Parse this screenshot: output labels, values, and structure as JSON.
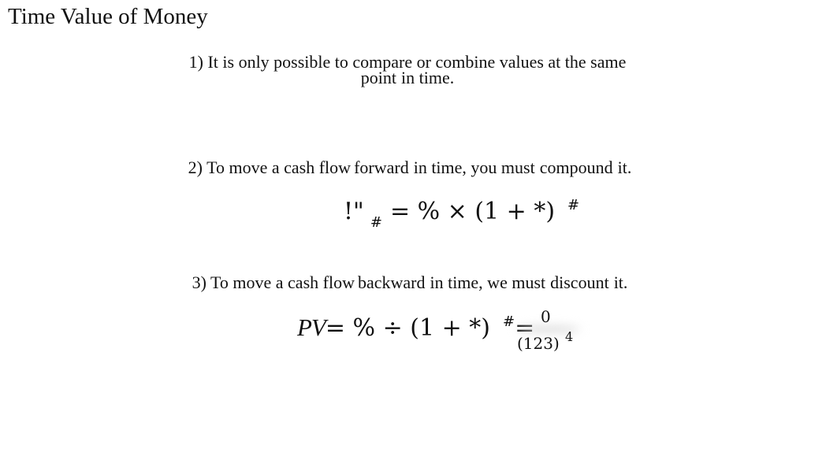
{
  "slide": {
    "title": "Time Value of Money",
    "points": [
      {
        "line1": "1) It is only possible to compare or combine values at the same",
        "line2_a": "point",
        "line2_b": "in time."
      },
      {
        "prefix": "2) To move a cash flow",
        "keyword": "forward",
        "middle": "in time, you must",
        "action": "compound",
        "suffix": "it."
      },
      {
        "prefix": "3) To move a cash flow",
        "keyword": "backward",
        "middle": "in time, we must",
        "action": "discount",
        "suffix": "it."
      }
    ],
    "formula_future_value": {
      "lhs": "!\"",
      "subscript": "#",
      "rhs": "= % × (1 + *)",
      "exponent": "#"
    },
    "formula_present_value": {
      "lhs": "PV",
      "rhs": "= % ÷ (1 + *)",
      "exponent": "#",
      "equals": "=",
      "fraction_numerator": "0",
      "fraction_denominator": "(123)",
      "fraction_exponent": "4"
    }
  }
}
